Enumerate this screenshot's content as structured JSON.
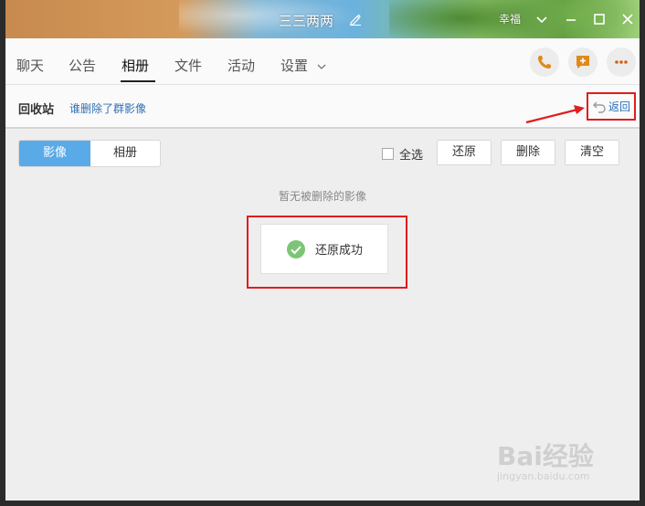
{
  "window": {
    "title": "三三两两",
    "top_right_label": "幸福",
    "minimize": "minimize-icon",
    "maximize": "maximize-icon",
    "close": "close-icon"
  },
  "tabs": [
    {
      "label": "聊天"
    },
    {
      "label": "公告"
    },
    {
      "label": "相册"
    },
    {
      "label": "文件"
    },
    {
      "label": "活动"
    },
    {
      "label": "设置"
    }
  ],
  "active_tab": "相册",
  "actions": {
    "call": "phone-icon",
    "add_app": "app-add-icon",
    "more": "more-icon"
  },
  "recycle": {
    "title": "回收站",
    "link": "谁删除了群影像",
    "back_label": "返回"
  },
  "segment": {
    "items": [
      "影像",
      "相册"
    ],
    "selected": "影像"
  },
  "toolbar": {
    "select_all": "全选",
    "restore": "还原",
    "delete": "删除",
    "clear": "清空"
  },
  "empty_message": "暂无被删除的影像",
  "toast": {
    "message": "还原成功"
  },
  "watermark": {
    "brand": "Bai经验",
    "url": "jingyan.baidu.com"
  },
  "colors": {
    "accent_blue": "#5aaae8",
    "link_blue": "#2f6fb5",
    "highlight_red": "#e11d1d",
    "success_green": "#7cc576"
  }
}
